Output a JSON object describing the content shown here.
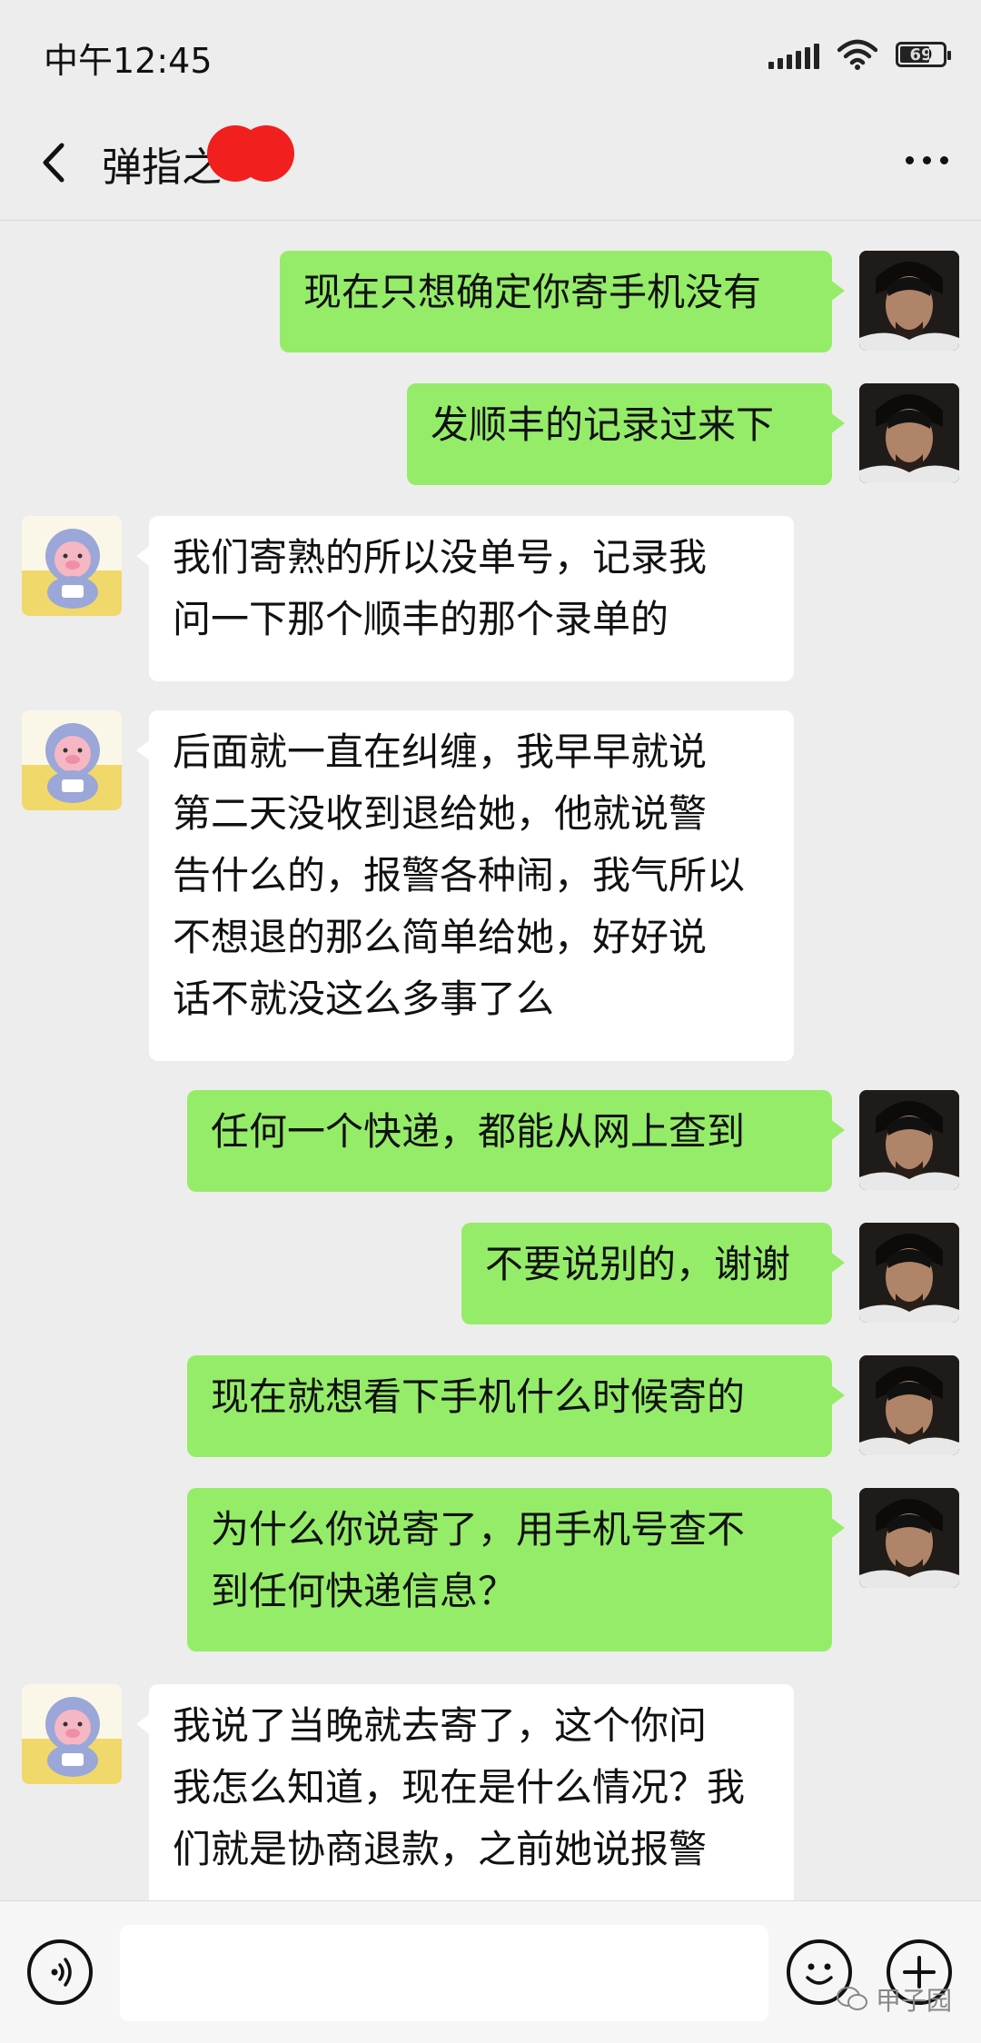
{
  "status": {
    "time": "中午12:45",
    "battery": "69"
  },
  "chat": {
    "title": "弹指之"
  },
  "messages": [
    {
      "sender": "me",
      "text": "现在只想确定你寄手机没有"
    },
    {
      "sender": "me",
      "text": "发顺丰的记录过来下"
    },
    {
      "sender": "them",
      "text": "我们寄熟的所以没单号，记录我\n问一下那个顺丰的那个录单的"
    },
    {
      "sender": "them",
      "text": "后面就一直在纠缠，我早早就说\n第二天没收到退给她，他就说警\n告什么的，报警各种闹，我气所以\n不想退的那么简单给她，好好说\n话不就没这么多事了么"
    },
    {
      "sender": "me",
      "text": "任何一个快递，都能从网上查到"
    },
    {
      "sender": "me",
      "text": "不要说别的，谢谢"
    },
    {
      "sender": "me",
      "text": "现在就想看下手机什么时候寄的"
    },
    {
      "sender": "me",
      "text": "为什么你说寄了，用手机号查不\n到任何快递信息？"
    },
    {
      "sender": "them",
      "text": "我说了当晚就去寄了，这个你问\n我怎么知道，现在是什么情况？我\n们就是协商退款，之前她说报警"
    }
  ],
  "input": {
    "placeholder": ""
  },
  "watermark": {
    "text": "甲子园"
  },
  "colors": {
    "my_bubble": "#95ec69",
    "their_bubble": "#ffffff",
    "background": "#ededed",
    "redaction": "#f21f1f"
  },
  "icons": [
    "back-arrow-icon",
    "more-dots-icon",
    "voice-icon",
    "emoji-icon",
    "plus-icon",
    "wechat-icon"
  ]
}
